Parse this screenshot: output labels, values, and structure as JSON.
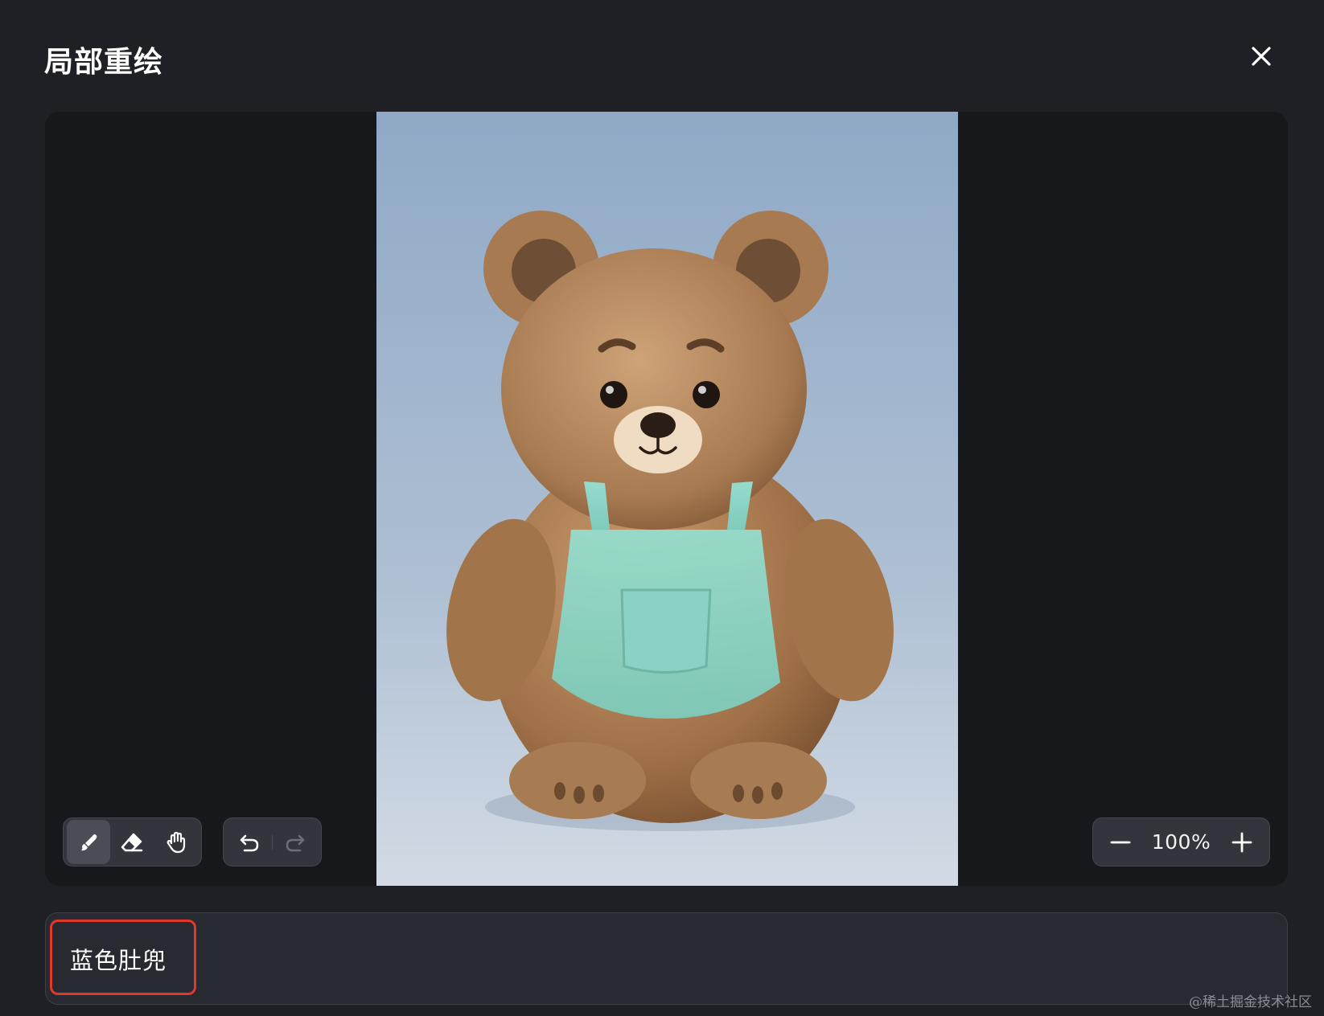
{
  "dialog": {
    "title": "局部重绘",
    "close_icon": "close-icon"
  },
  "canvas": {
    "image_description_icon": "teddy-bear-image",
    "tools": [
      {
        "name": "brush",
        "icon": "brush-icon",
        "active": true
      },
      {
        "name": "eraser",
        "icon": "eraser-icon",
        "active": false
      },
      {
        "name": "hand",
        "icon": "hand-icon",
        "active": false
      }
    ],
    "history": [
      {
        "name": "undo",
        "icon": "undo-icon"
      },
      {
        "name": "redo",
        "icon": "redo-icon"
      }
    ],
    "zoom": {
      "value": "100%",
      "minus_icon": "minus-icon",
      "plus_icon": "plus-icon"
    }
  },
  "prompt": {
    "value": "蓝色肚兜"
  },
  "watermark": "@稀土掘金技术社区",
  "colors": {
    "background": "#1f2026",
    "panel": "#17181c",
    "highlight": "#e0392a",
    "apron": "#8fd4c6"
  }
}
